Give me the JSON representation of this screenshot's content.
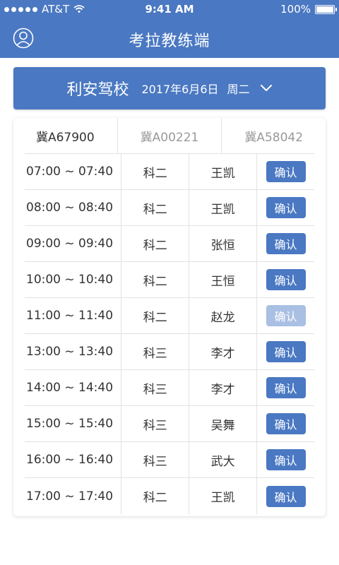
{
  "status_bar": {
    "carrier": "AT&T",
    "time": "9:41 AM",
    "battery": "100%"
  },
  "nav": {
    "title": "考拉教练端",
    "user_icon": "user-circle-icon"
  },
  "school": {
    "name": "利安驾校",
    "date": "2017年6月6日",
    "weekday": "周二",
    "dropdown_icon": "chevron-down-icon"
  },
  "plates": [
    "冀A67900",
    "冀A00221",
    "冀A58042"
  ],
  "selected_plate": 0,
  "schedule": [
    {
      "time": "07:00 ~ 07:40",
      "subject": "科二",
      "coach": "王凯",
      "action": "确认",
      "enabled": true
    },
    {
      "time": "08:00 ~ 08:40",
      "subject": "科二",
      "coach": "王凯",
      "action": "确认",
      "enabled": true
    },
    {
      "time": "09:00 ~ 09:40",
      "subject": "科二",
      "coach": "张恒",
      "action": "确认",
      "enabled": true
    },
    {
      "time": "10:00 ~ 10:40",
      "subject": "科二",
      "coach": "王恒",
      "action": "确认",
      "enabled": true
    },
    {
      "time": "11:00 ~ 11:40",
      "subject": "科二",
      "coach": "赵龙",
      "action": "确认",
      "enabled": false
    },
    {
      "time": "13:00 ~ 13:40",
      "subject": "科三",
      "coach": "李才",
      "action": "确认",
      "enabled": true
    },
    {
      "time": "14:00 ~ 14:40",
      "subject": "科三",
      "coach": "李才",
      "action": "确认",
      "enabled": true
    },
    {
      "time": "15:00 ~ 15:40",
      "subject": "科三",
      "coach": "吴舞",
      "action": "确认",
      "enabled": true
    },
    {
      "time": "16:00 ~ 16:40",
      "subject": "科三",
      "coach": "武大",
      "action": "确认",
      "enabled": true
    },
    {
      "time": "17:00 ~ 17:40",
      "subject": "科二",
      "coach": "王凯",
      "action": "确认",
      "enabled": true
    }
  ]
}
